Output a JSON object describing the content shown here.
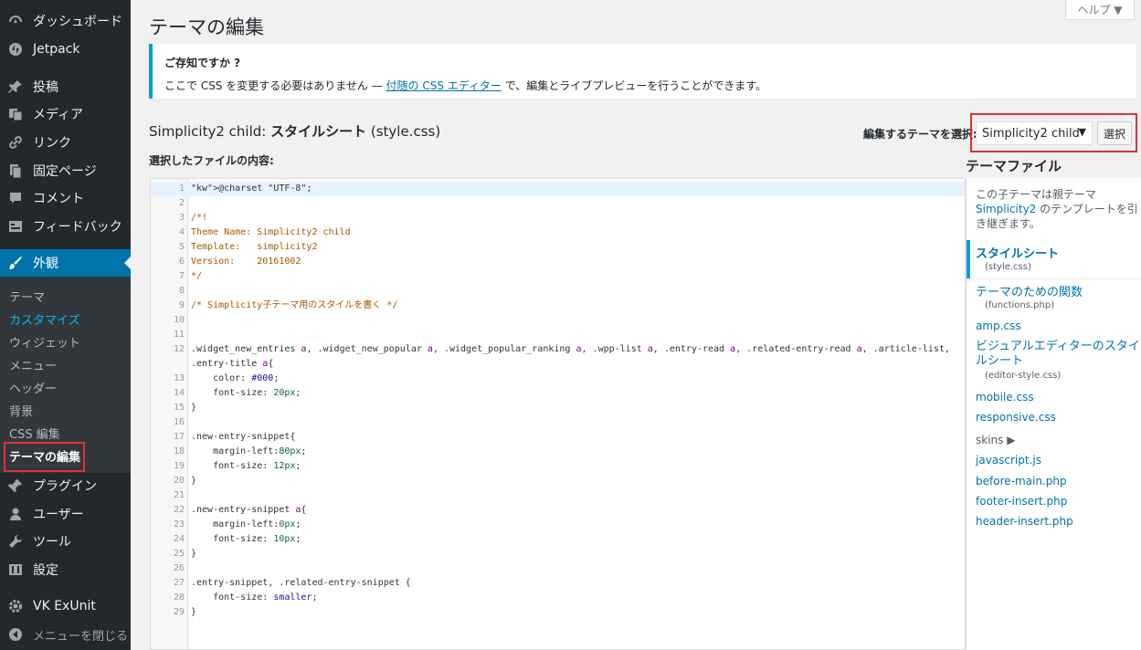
{
  "sidebar": {
    "top_items": [
      {
        "label": "ダッシュボード",
        "icon": "dashboard-icon"
      },
      {
        "label": "Jetpack",
        "icon": "jetpack-icon"
      }
    ],
    "items": [
      {
        "label": "投稿",
        "icon": "pin-icon"
      },
      {
        "label": "メディア",
        "icon": "media-icon"
      },
      {
        "label": "リンク",
        "icon": "link-icon"
      },
      {
        "label": "固定ページ",
        "icon": "page-icon"
      },
      {
        "label": "コメント",
        "icon": "comment-icon"
      },
      {
        "label": "フィードバック",
        "icon": "feedback-icon"
      }
    ],
    "current": {
      "label": "外観",
      "icon": "brush-icon"
    },
    "submenu": [
      "テーマ",
      "カスタマイズ",
      "ウィジェット",
      "メニュー",
      "ヘッダー",
      "背景",
      "CSS 編集",
      "テーマの編集"
    ],
    "after_items": [
      {
        "label": "プラグイン",
        "icon": "plugin-icon"
      },
      {
        "label": "ユーザー",
        "icon": "user-icon"
      },
      {
        "label": "ツール",
        "icon": "tool-icon"
      },
      {
        "label": "設定",
        "icon": "settings-icon"
      }
    ],
    "vk": {
      "label": "VK ExUnit",
      "icon": "gear-icon"
    },
    "collapse": {
      "label": "メニューを閉じる",
      "icon": "collapse-icon"
    }
  },
  "header": {
    "help": "ヘルプ ▼",
    "title": "テーマの編集"
  },
  "notice": {
    "title": "ご存知ですか ?",
    "text_before": "ここで CSS を変更する必要はありません — ",
    "link": "付随の CSS エディター",
    "text_after": " で、編集とライブプレビューを行うことができます。"
  },
  "file_heading": {
    "theme": "Simplicity2 child: ",
    "file": "スタイルシート",
    "filename": " (style.css)"
  },
  "content_label": "選択したファイルの内容:",
  "theme_selector": {
    "label": "編集するテーマを選択:",
    "value": "Simplicity2 child",
    "button": "選択"
  },
  "code_lines": [
    "@charset \"UTF-8\";",
    "",
    "/*!",
    "Theme Name: Simplicity2 child",
    "Template:   simplicity2",
    "Version:    20161002",
    "*/",
    "",
    "/* Simplicity子テーマ用のスタイルを書く */",
    "",
    "",
    ".widget_new_entries a, .widget_new_popular a, .widget_popular_ranking a, .wpp-list a, .entry-read a, .related-entry-read a, .article-list,",
    "    color: #000;",
    "    font-size: 20px;",
    "}",
    "",
    ".new-entry-snippet{",
    "    margin-left:80px;",
    "    font-size: 12px;",
    "}",
    "",
    ".new-entry-snippet a{",
    "    margin-left:0px;",
    "    font-size: 10px;",
    "}",
    "",
    ".entry-snippet, .related-entry-snippet {",
    "    font-size: smaller;",
    "}"
  ],
  "code_wrap": ".entry-title a{",
  "files": {
    "title": "テーマファイル",
    "desc_before": "この子テーマは親テーマ ",
    "desc_link": "Simplicity2",
    "desc_after": " のテンプレートを引き継ぎます。",
    "list": [
      {
        "label": "スタイルシート",
        "sub": "(style.css)"
      },
      {
        "label": "テーマのための関数",
        "sub": "(functions.php)"
      },
      {
        "label": "amp.css"
      },
      {
        "label": "ビジュアルエディターのスタイルシート",
        "sub": "(editor-style.css)"
      },
      {
        "label": "mobile.css"
      },
      {
        "label": "responsive.css"
      },
      {
        "label": "skins ▶"
      },
      {
        "label": "javascript.js"
      },
      {
        "label": "before-main.php"
      },
      {
        "label": "footer-insert.php"
      },
      {
        "label": "header-insert.php"
      }
    ]
  }
}
